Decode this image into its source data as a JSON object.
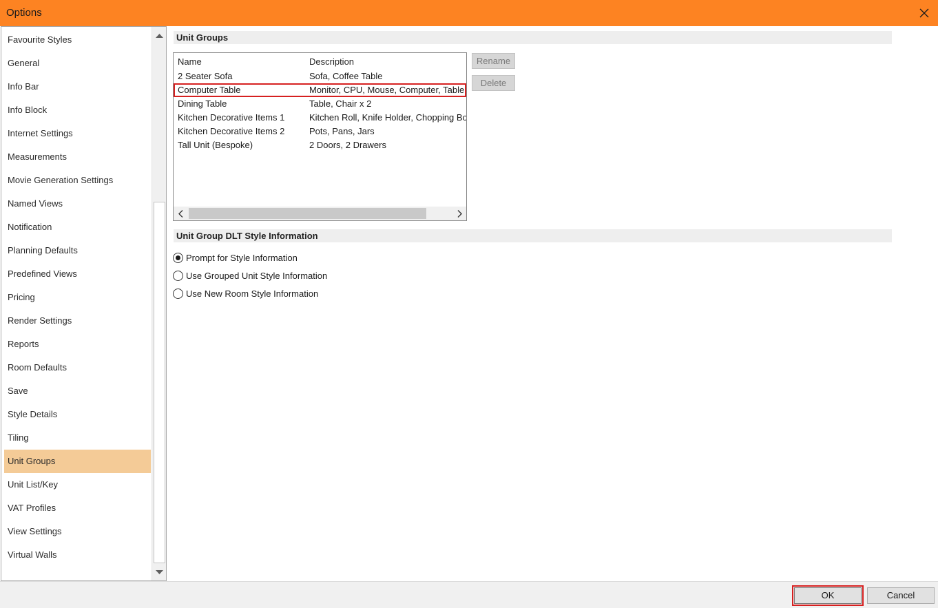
{
  "window": {
    "title": "Options",
    "close_icon": "close-icon"
  },
  "sidebar": {
    "items": [
      {
        "label": "Favourite Styles"
      },
      {
        "label": "General"
      },
      {
        "label": "Info Bar"
      },
      {
        "label": "Info Block"
      },
      {
        "label": "Internet Settings"
      },
      {
        "label": "Measurements"
      },
      {
        "label": "Movie Generation Settings"
      },
      {
        "label": "Named Views"
      },
      {
        "label": "Notification"
      },
      {
        "label": "Planning Defaults"
      },
      {
        "label": "Predefined Views"
      },
      {
        "label": "Pricing"
      },
      {
        "label": "Render Settings"
      },
      {
        "label": "Reports"
      },
      {
        "label": "Room Defaults"
      },
      {
        "label": "Save"
      },
      {
        "label": "Style Details"
      },
      {
        "label": "Tiling"
      },
      {
        "label": "Unit Groups",
        "selected": true
      },
      {
        "label": "Unit List/Key"
      },
      {
        "label": "VAT Profiles"
      },
      {
        "label": "View Settings"
      },
      {
        "label": "Virtual Walls"
      }
    ]
  },
  "unit_groups": {
    "header": "Unit Groups",
    "columns": [
      "Name",
      "Description"
    ],
    "rows": [
      {
        "name": "2 Seater Sofa",
        "description": "Sofa, Coffee Table"
      },
      {
        "name": "Computer Table",
        "description": "Monitor, CPU, Mouse, Computer, Table",
        "highlighted": true
      },
      {
        "name": "Dining Table",
        "description": "Table, Chair x 2"
      },
      {
        "name": "Kitchen Decorative Items 1",
        "description": "Kitchen Roll, Knife Holder, Chopping Board"
      },
      {
        "name": "Kitchen Decorative Items 2",
        "description": "Pots, Pans, Jars"
      },
      {
        "name": "Tall Unit (Bespoke)",
        "description": "2 Doors, 2 Drawers"
      }
    ],
    "rename_label": "Rename",
    "delete_label": "Delete"
  },
  "dlt_style": {
    "header": "Unit Group DLT Style Information",
    "options": [
      {
        "label": "Prompt for Style Information",
        "checked": true
      },
      {
        "label": "Use Grouped Unit Style Information",
        "checked": false
      },
      {
        "label": "Use New Room Style Information",
        "checked": false
      }
    ]
  },
  "footer": {
    "ok_label": "OK",
    "cancel_label": "Cancel"
  },
  "colors": {
    "titlebar": "#fd8322",
    "selected_item": "#f4cb97",
    "highlight": "#d62020"
  }
}
